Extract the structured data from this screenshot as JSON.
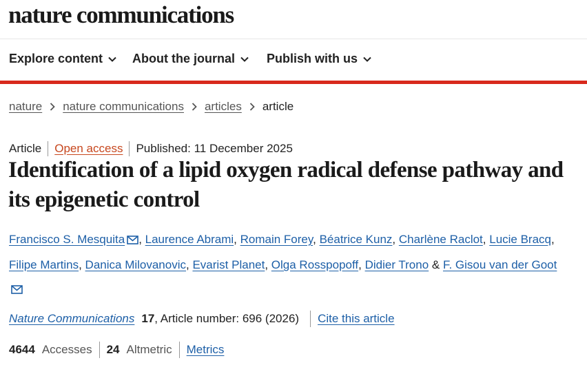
{
  "site": {
    "logo": "nature communications"
  },
  "nav": {
    "items": [
      {
        "label": "Explore content"
      },
      {
        "label": "About the journal"
      },
      {
        "label": "Publish with us"
      }
    ],
    "accent_color": "#d8291c"
  },
  "breadcrumb": {
    "items": [
      "nature",
      "nature communications",
      "articles"
    ],
    "current": "article"
  },
  "article": {
    "type": "Article",
    "access": "Open access",
    "published": "Published: 11 December 2025",
    "title": "Identification of a lipid oxygen radical defense pathway and its epigenetic control",
    "authors": [
      "Francisco S. Mesquita",
      "Laurence Abrami",
      "Romain Forey",
      "Béatrice Kunz",
      "Charlène Raclot",
      "Lucie Bracq",
      "Filipe Martins",
      "Danica Milovanovic",
      "Evarist Planet",
      "Olga Rosspopoff",
      "Didier Trono",
      "F. Gisou van der Goot"
    ],
    "author_separator": ",",
    "author_last_joiner": "&",
    "corresponding_icon": "mail-icon"
  },
  "citation": {
    "journal": "Nature Communications",
    "volume": "17",
    "article_number_text": ", Article number: 696 (2026)",
    "cite_label": "Cite this article"
  },
  "metrics": {
    "accesses_count": "4644",
    "accesses_label": "Accesses",
    "altmetric_count": "24",
    "altmetric_label": "Altmetric",
    "metrics_label": "Metrics"
  },
  "colors": {
    "link_blue": "#1d5fa7",
    "open_access_orange": "#c7471e"
  }
}
